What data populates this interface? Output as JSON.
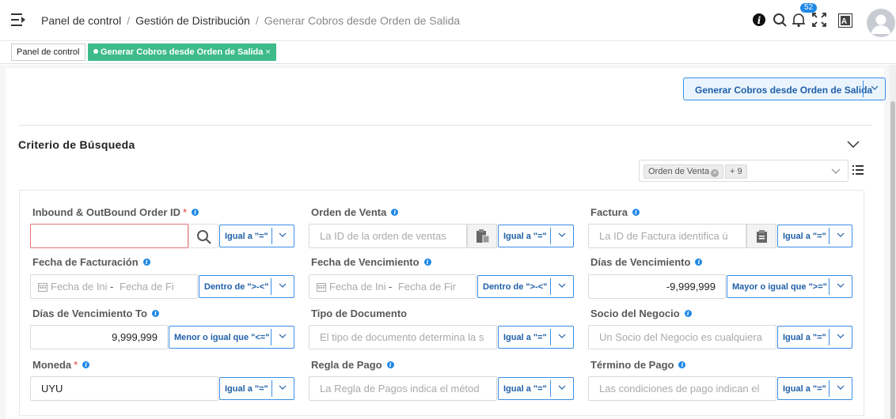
{
  "breadcrumb": {
    "items": [
      "Panel de control",
      "Gestión de Distribución",
      "Generar Cobros desde Orden de Salida"
    ],
    "separator": "/"
  },
  "header": {
    "notification_count": "52",
    "translate_icon_label": "A"
  },
  "tabs": [
    {
      "label": "Panel de control"
    },
    {
      "label": "Generar Cobros desde Orden de Salida",
      "close": "×"
    }
  ],
  "action_button": {
    "label": "Generar Cobros desde Orden de Salida"
  },
  "search_section": {
    "title": "Criterio de Búsqueda"
  },
  "filter_chips": {
    "chip": "Orden de Venta",
    "more": "+ 9"
  },
  "fields": {
    "order_id": {
      "label": "Inbound & OutBound Order ID",
      "required": "*",
      "value": "",
      "operator": "Igual a \"=\""
    },
    "sales_order": {
      "label": "Orden de Venta",
      "placeholder": "La ID de la orden de ventas",
      "operator": "Igual a \"=\""
    },
    "invoice": {
      "label": "Factura",
      "placeholder": "La ID de Factura identifica ú",
      "operator": "Igual a \"=\""
    },
    "invoice_date": {
      "label": "Fecha de Facturación",
      "from_placeholder": "Fecha de Ini",
      "range_sep": "-",
      "to_placeholder": "Fecha de Fi",
      "operator": "Dentro de \">-<\""
    },
    "due_date": {
      "label": "Fecha de Vencimiento",
      "from_placeholder": "Fecha de Ini",
      "range_sep": "-",
      "to_placeholder": "Fecha de Fir",
      "operator": "Dentro de \">-<\""
    },
    "days_due": {
      "label": "Días de Vencimiento",
      "value": "-9,999,999",
      "operator": "Mayor o igual que \">=\""
    },
    "days_due_to": {
      "label": "Días de Vencimiento To",
      "value": "9,999,999",
      "operator": "Menor o igual que \"<=\""
    },
    "doc_type": {
      "label": "Tipo de Documento",
      "placeholder": "El tipo de documento determina la s",
      "operator": "Igual a \"=\""
    },
    "business_partner": {
      "label": "Socio del Negocio",
      "placeholder": "Un Socio del Negocio es cualquiera",
      "operator": "Igual a \"=\""
    },
    "currency": {
      "label": "Moneda",
      "required": "*",
      "value": "UYU",
      "operator": "Igual a \"=\""
    },
    "payment_rule": {
      "label": "Regla de Pago",
      "placeholder": "La Regla de Pagos indica el métod",
      "operator": "Igual a \"=\""
    },
    "payment_term": {
      "label": "Término de Pago",
      "placeholder": "Las condiciones de pago indican el",
      "operator": "Igual a \"=\""
    }
  },
  "colors": {
    "accent": "#3a8ee6",
    "tab_active": "#3dbb8a",
    "badge": "#1e88e5",
    "required": "#e53935"
  }
}
